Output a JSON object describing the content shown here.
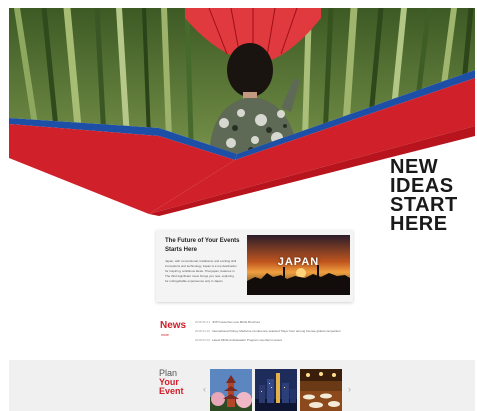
{
  "hero": {
    "tagline": [
      "NEW",
      "IDEAS",
      "START",
      "HERE"
    ],
    "image_icon": "woman-with-red-umbrella-bamboo-forest"
  },
  "feature_card": {
    "title_line1": "The Future of Your Events",
    "title_line2": "Starts Here",
    "body_lines": [
      "Japan; with conventional, traditional, and exciting skill",
      "innovations and technology, Japan is a top destination",
      "for inspiring, ambitious ideas. That japan, features in",
      "The third significant move brings you new, exploring",
      "for unforgettable experiences only in Japan."
    ],
    "image_label": "JAPAN"
  },
  "news": {
    "heading": "News",
    "more_link": "more",
    "items": [
      {
        "date": "2018.05.21",
        "text": "JNTO launches new MICE Brochure"
      },
      {
        "date": "2018.04.10",
        "text": "International Kidney Medicine Conference selected Tokyo from among intense global competition"
      },
      {
        "date": "2018.03.02",
        "text": "Latest MICE Ambassador Program members named"
      }
    ]
  },
  "plan": {
    "line1": "Plan",
    "line2": "Your",
    "line3": "Event",
    "prev_arrow": "‹",
    "next_arrow": "›",
    "thumbnails": [
      "pagoda-cherry-blossoms-photo",
      "city-night-skyline-photo",
      "banquet-hall-photo"
    ]
  },
  "colors": {
    "accent_red": "#d0202a",
    "accent_blue": "#1e4fa6"
  }
}
